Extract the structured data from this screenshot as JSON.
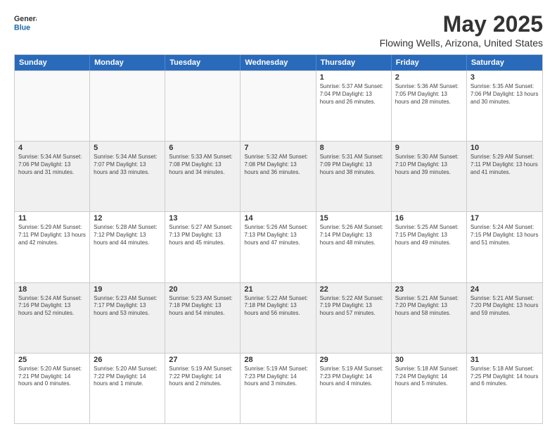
{
  "logo": {
    "general": "General",
    "blue": "Blue"
  },
  "title": {
    "month_year": "May 2025",
    "location": "Flowing Wells, Arizona, United States"
  },
  "calendar": {
    "headers": [
      "Sunday",
      "Monday",
      "Tuesday",
      "Wednesday",
      "Thursday",
      "Friday",
      "Saturday"
    ],
    "rows": [
      [
        {
          "day": "",
          "empty": true
        },
        {
          "day": "",
          "empty": true
        },
        {
          "day": "",
          "empty": true
        },
        {
          "day": "",
          "empty": true
        },
        {
          "day": "1",
          "info": "Sunrise: 5:37 AM\nSunset: 7:04 PM\nDaylight: 13 hours and 26 minutes."
        },
        {
          "day": "2",
          "info": "Sunrise: 5:36 AM\nSunset: 7:05 PM\nDaylight: 13 hours and 28 minutes."
        },
        {
          "day": "3",
          "info": "Sunrise: 5:35 AM\nSunset: 7:06 PM\nDaylight: 13 hours and 30 minutes."
        }
      ],
      [
        {
          "day": "4",
          "info": "Sunrise: 5:34 AM\nSunset: 7:06 PM\nDaylight: 13 hours and 31 minutes."
        },
        {
          "day": "5",
          "info": "Sunrise: 5:34 AM\nSunset: 7:07 PM\nDaylight: 13 hours and 33 minutes."
        },
        {
          "day": "6",
          "info": "Sunrise: 5:33 AM\nSunset: 7:08 PM\nDaylight: 13 hours and 34 minutes."
        },
        {
          "day": "7",
          "info": "Sunrise: 5:32 AM\nSunset: 7:08 PM\nDaylight: 13 hours and 36 minutes."
        },
        {
          "day": "8",
          "info": "Sunrise: 5:31 AM\nSunset: 7:09 PM\nDaylight: 13 hours and 38 minutes."
        },
        {
          "day": "9",
          "info": "Sunrise: 5:30 AM\nSunset: 7:10 PM\nDaylight: 13 hours and 39 minutes."
        },
        {
          "day": "10",
          "info": "Sunrise: 5:29 AM\nSunset: 7:11 PM\nDaylight: 13 hours and 41 minutes."
        }
      ],
      [
        {
          "day": "11",
          "info": "Sunrise: 5:29 AM\nSunset: 7:11 PM\nDaylight: 13 hours and 42 minutes."
        },
        {
          "day": "12",
          "info": "Sunrise: 5:28 AM\nSunset: 7:12 PM\nDaylight: 13 hours and 44 minutes."
        },
        {
          "day": "13",
          "info": "Sunrise: 5:27 AM\nSunset: 7:13 PM\nDaylight: 13 hours and 45 minutes."
        },
        {
          "day": "14",
          "info": "Sunrise: 5:26 AM\nSunset: 7:13 PM\nDaylight: 13 hours and 47 minutes."
        },
        {
          "day": "15",
          "info": "Sunrise: 5:26 AM\nSunset: 7:14 PM\nDaylight: 13 hours and 48 minutes."
        },
        {
          "day": "16",
          "info": "Sunrise: 5:25 AM\nSunset: 7:15 PM\nDaylight: 13 hours and 49 minutes."
        },
        {
          "day": "17",
          "info": "Sunrise: 5:24 AM\nSunset: 7:15 PM\nDaylight: 13 hours and 51 minutes."
        }
      ],
      [
        {
          "day": "18",
          "info": "Sunrise: 5:24 AM\nSunset: 7:16 PM\nDaylight: 13 hours and 52 minutes."
        },
        {
          "day": "19",
          "info": "Sunrise: 5:23 AM\nSunset: 7:17 PM\nDaylight: 13 hours and 53 minutes."
        },
        {
          "day": "20",
          "info": "Sunrise: 5:23 AM\nSunset: 7:18 PM\nDaylight: 13 hours and 54 minutes."
        },
        {
          "day": "21",
          "info": "Sunrise: 5:22 AM\nSunset: 7:18 PM\nDaylight: 13 hours and 56 minutes."
        },
        {
          "day": "22",
          "info": "Sunrise: 5:22 AM\nSunset: 7:19 PM\nDaylight: 13 hours and 57 minutes."
        },
        {
          "day": "23",
          "info": "Sunrise: 5:21 AM\nSunset: 7:20 PM\nDaylight: 13 hours and 58 minutes."
        },
        {
          "day": "24",
          "info": "Sunrise: 5:21 AM\nSunset: 7:20 PM\nDaylight: 13 hours and 59 minutes."
        }
      ],
      [
        {
          "day": "25",
          "info": "Sunrise: 5:20 AM\nSunset: 7:21 PM\nDaylight: 14 hours and 0 minutes."
        },
        {
          "day": "26",
          "info": "Sunrise: 5:20 AM\nSunset: 7:22 PM\nDaylight: 14 hours and 1 minute."
        },
        {
          "day": "27",
          "info": "Sunrise: 5:19 AM\nSunset: 7:22 PM\nDaylight: 14 hours and 2 minutes."
        },
        {
          "day": "28",
          "info": "Sunrise: 5:19 AM\nSunset: 7:23 PM\nDaylight: 14 hours and 3 minutes."
        },
        {
          "day": "29",
          "info": "Sunrise: 5:19 AM\nSunset: 7:23 PM\nDaylight: 14 hours and 4 minutes."
        },
        {
          "day": "30",
          "info": "Sunrise: 5:18 AM\nSunset: 7:24 PM\nDaylight: 14 hours and 5 minutes."
        },
        {
          "day": "31",
          "info": "Sunrise: 5:18 AM\nSunset: 7:25 PM\nDaylight: 14 hours and 6 minutes."
        }
      ]
    ]
  }
}
